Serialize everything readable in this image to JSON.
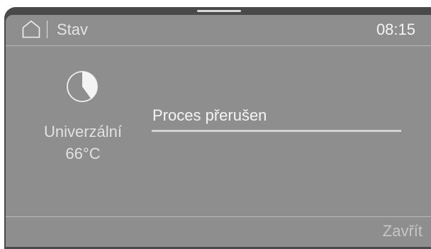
{
  "header": {
    "title": "Stav",
    "time": "08:15",
    "home_icon": "home-icon"
  },
  "program": {
    "icon": "pie-chart-icon",
    "name": "Univerzální",
    "temperature": "66°C"
  },
  "status": {
    "message": "Proces přerušen",
    "progress": 1.0
  },
  "footer": {
    "close_label": "Zavřít"
  },
  "colors": {
    "screen_bg": "#8e8e8e",
    "bezel": "#4a4a4a",
    "text": "#e3e3e3"
  }
}
